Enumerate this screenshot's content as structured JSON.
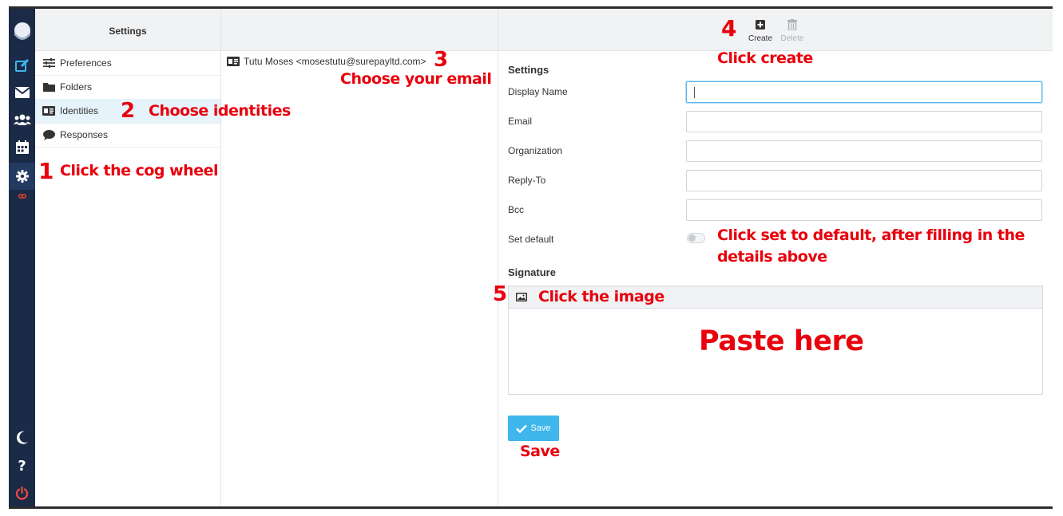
{
  "sidebar_title": "Settings",
  "settings_menu": [
    {
      "label": "Preferences",
      "icon": "sliders-icon"
    },
    {
      "label": "Folders",
      "icon": "folder-icon"
    },
    {
      "label": "Identities",
      "icon": "id-card-icon"
    },
    {
      "label": "Responses",
      "icon": "comment-icon"
    }
  ],
  "identity": {
    "label": "Tutu Moses <mosestutu@surepayltd.com>",
    "icon": "id-card-icon"
  },
  "toolbar": {
    "create_label": "Create",
    "delete_label": "Delete"
  },
  "form": {
    "title": "Settings",
    "display_name_label": "Display Name",
    "email_label": "Email",
    "organization_label": "Organization",
    "reply_to_label": "Reply-To",
    "bcc_label": "Bcc",
    "set_default_label": "Set default",
    "display_name_value": "",
    "email_value": "",
    "organization_value": "",
    "reply_to_value": "",
    "bcc_value": "",
    "set_default_on": false
  },
  "signature": {
    "title": "Signature"
  },
  "save_label": "Save",
  "annotations": {
    "step1_num": "1",
    "step1_text": "Click the cog wheel",
    "step2_num": "2",
    "step2_text": "Choose identities",
    "step3_num": "3",
    "step3_text": "Choose your email",
    "step4_num": "4",
    "step4_text": "Click create",
    "set_default_line1": "Click set to default, after filling in the",
    "set_default_line2": "details above",
    "step5_num": "5",
    "step5_text": "Click the image",
    "paste_text": "Paste here",
    "save_text": "Save"
  },
  "colors": {
    "rail": "#1b2a47",
    "accent": "#3fb6ec",
    "annotation": "#e8000d",
    "selected_row": "#e6f3fb"
  }
}
